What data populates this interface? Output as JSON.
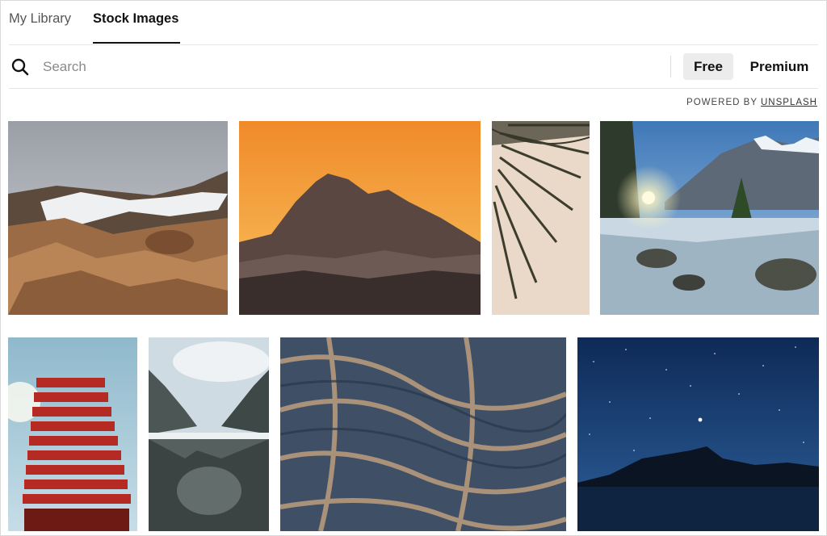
{
  "tabs": [
    {
      "label": "My Library",
      "active": false
    },
    {
      "label": "Stock Images",
      "active": true
    }
  ],
  "search": {
    "placeholder": "Search",
    "value": ""
  },
  "filters": {
    "free_label": "Free",
    "premium_label": "Premium",
    "selected": "Free"
  },
  "credit": {
    "prefix": "POWERED BY ",
    "link": "UNSPLASH"
  },
  "images": [
    {
      "subject": "Snowy volcanic mountain landscape"
    },
    {
      "subject": "Mountain silhouette at orange sunset"
    },
    {
      "subject": "Palm frond on beige background"
    },
    {
      "subject": "Alpine lake with sunburst and snowy peaks"
    },
    {
      "subject": "Red stacked tower against blue sky"
    },
    {
      "subject": "Mountain lake reflection with clouds"
    },
    {
      "subject": "Aerial view of braided river delta"
    },
    {
      "subject": "Starry night sky over mountain lake"
    }
  ],
  "colors": {
    "accent": "#111111",
    "pill_bg": "#ececec",
    "divider": "#e6e6e6"
  }
}
